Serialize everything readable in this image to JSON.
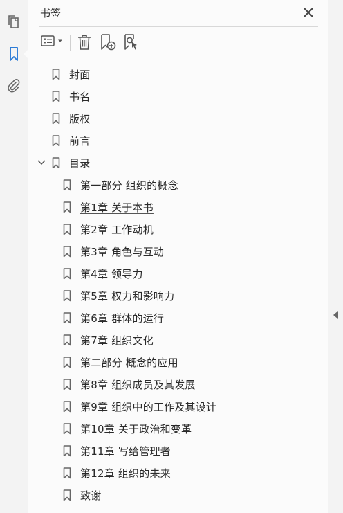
{
  "rail": {
    "items": [
      {
        "icon": "page-thumbnails-icon"
      },
      {
        "icon": "bookmark-icon",
        "active": true
      },
      {
        "icon": "attachment-icon"
      }
    ],
    "accent": "#2b7bd6"
  },
  "panel": {
    "title": "书签",
    "toolbar": {
      "options_icon": "bookmark-options-icon",
      "delete_icon": "trash-icon",
      "new_bookmark_icon": "new-bookmark-icon",
      "find_bookmark_icon": "find-current-bookmark-icon"
    }
  },
  "bookmarks": [
    {
      "label": "封面",
      "level": 0
    },
    {
      "label": "书名",
      "level": 0
    },
    {
      "label": "版权",
      "level": 0
    },
    {
      "label": "前言",
      "level": 0
    },
    {
      "label": "目录",
      "level": 0,
      "expanded": true
    },
    {
      "label": "第一部分  组织的概念",
      "level": 1
    },
    {
      "label": " 第1章  关于本书",
      "level": 1,
      "underlined": true
    },
    {
      "label": " 第2章  工作动机",
      "level": 1
    },
    {
      "label": " 第3章  角色与互动",
      "level": 1
    },
    {
      "label": " 第4章  领导力",
      "level": 1
    },
    {
      "label": " 第5章  权力和影响力",
      "level": 1
    },
    {
      "label": " 第6章  群体的运行",
      "level": 1
    },
    {
      "label": " 第7章  组织文化",
      "level": 1
    },
    {
      "label": "第二部分  概念的应用",
      "level": 1
    },
    {
      "label": " 第8章  组织成员及其发展",
      "level": 1
    },
    {
      "label": " 第9章  组织中的工作及其设计",
      "level": 1
    },
    {
      "label": " 第10章  关于政治和变革",
      "level": 1
    },
    {
      "label": " 第11章  写给管理者",
      "level": 1
    },
    {
      "label": " 第12章  组织的未来",
      "level": 1
    },
    {
      "label": "致谢",
      "level": 1
    }
  ]
}
